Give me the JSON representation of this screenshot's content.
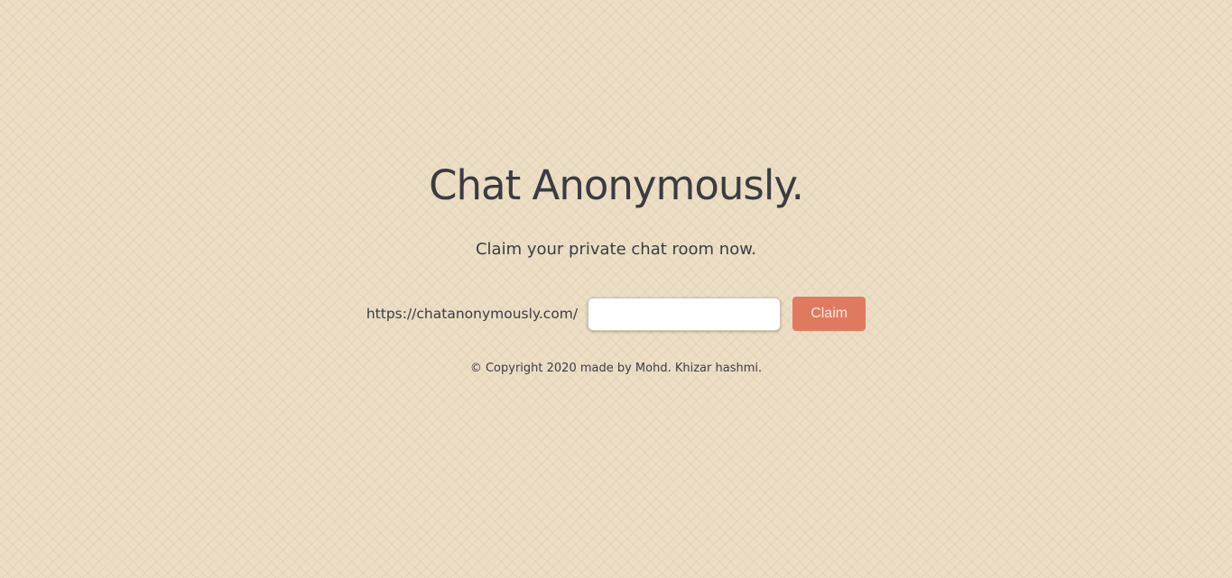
{
  "hero": {
    "title": "Chat Anonymously.",
    "subtitle": "Claim your private chat room now."
  },
  "claim_form": {
    "url_prefix": "https://chatanonymously.com/",
    "room_input_value": "",
    "room_input_placeholder": "",
    "claim_button_label": "Claim"
  },
  "footer": {
    "copyright": "© Copyright 2020 made by Mohd. Khizar hashmi."
  },
  "colors": {
    "background": "#ebdec4",
    "text": "#3b3b41",
    "accent": "#e07a5f",
    "button_text": "#fbe9e1"
  }
}
